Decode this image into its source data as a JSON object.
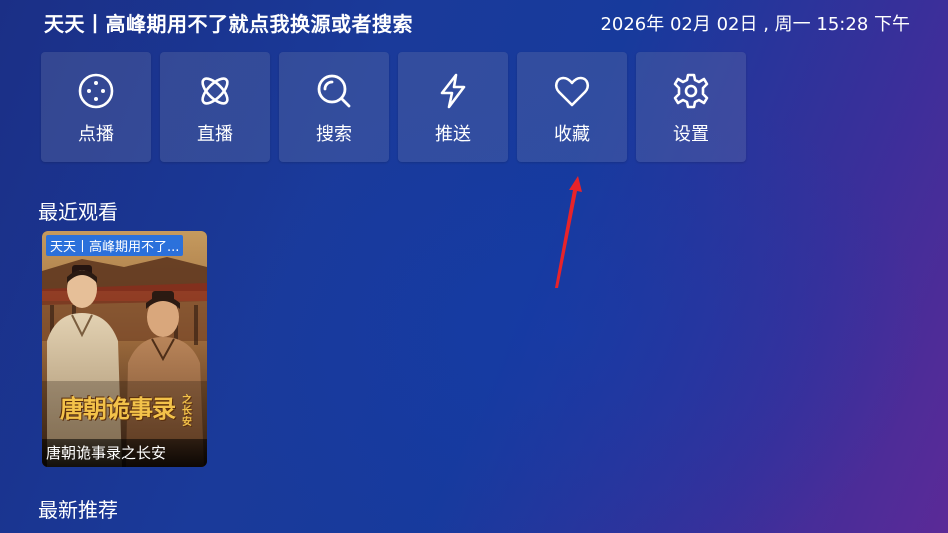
{
  "header": {
    "title": "天天丨高峰期用不了就点我换源或者搜索",
    "datetime": "2026年 02月 02日 , 周一 15:28 下午"
  },
  "menu": [
    {
      "label": "点播",
      "icon": "film-reel-icon"
    },
    {
      "label": "直播",
      "icon": "atom-icon"
    },
    {
      "label": "搜索",
      "icon": "search-icon"
    },
    {
      "label": "推送",
      "icon": "lightning-icon"
    },
    {
      "label": "收藏",
      "icon": "heart-icon"
    },
    {
      "label": "设置",
      "icon": "gear-icon"
    }
  ],
  "recent": {
    "title": "最近观看",
    "items": [
      {
        "source": "天天丨高峰期用不了...",
        "name": "唐朝诡事录之长安",
        "poster_title": "唐朝诡事录",
        "poster_subtitle": "之长安"
      }
    ]
  },
  "latest": {
    "title": "最新推荐"
  },
  "colors": {
    "accent_badge": "#1e6ee6",
    "annotation_arrow": "#e8232a"
  }
}
